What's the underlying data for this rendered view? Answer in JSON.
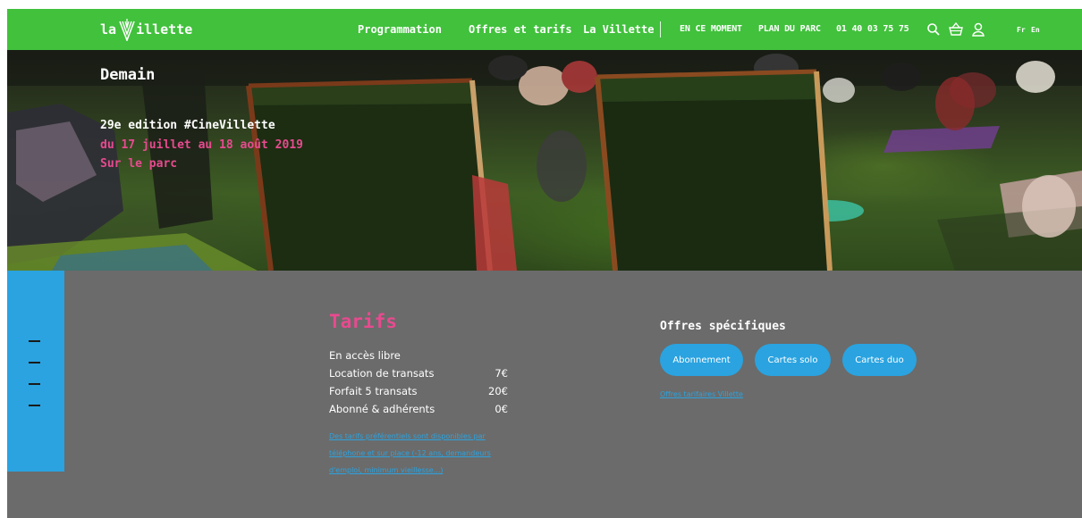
{
  "nav": {
    "logo_prefix": "la",
    "logo_suffix": "illette",
    "main": [
      "Programmation",
      "Offres et tarifs",
      "La Villette"
    ],
    "secondary": [
      "EN CE MOMENT",
      "PLAN DU PARC",
      "01 40 03 75 75"
    ],
    "icons": [
      "search-icon",
      "basket-icon",
      "user-icon"
    ],
    "languages": [
      "Fr",
      "En"
    ],
    "color": "#41c13c"
  },
  "hero": {
    "title": "Demain",
    "edition": "29e edition #CineVillette",
    "dates": "du 17 juillet au 18 août 2019",
    "place": "Sur le parc",
    "accent": "#e84a8f"
  },
  "sidebar": {
    "color": "#2aa3e0",
    "icons": [
      "menu-dash-icon",
      "menu-dash-icon",
      "menu-dash-icon",
      "menu-dash-icon"
    ]
  },
  "tarifs": {
    "title": "Tarifs",
    "rows": [
      {
        "label": "En accès libre",
        "price": ""
      },
      {
        "label": "Location de transats",
        "price": "7€"
      },
      {
        "label": "Forfait 5 transats",
        "price": "20€"
      },
      {
        "label": "Abonné & adhérents",
        "price": "0€"
      }
    ],
    "note": "Des tarifs préférentiels sont disponibles par téléphone et sur place (-12 ans, demandeurs d'emploi, minimum vieillesse...)"
  },
  "offres": {
    "title": "Offres spécifiques",
    "buttons": [
      "Abonnement",
      "Cartes solo",
      "Cartes duo"
    ],
    "link": "Offres tarifaires Villette"
  }
}
